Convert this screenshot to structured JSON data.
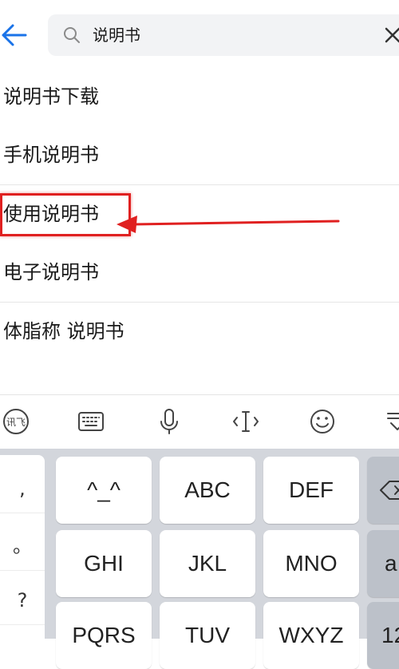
{
  "search": {
    "query": "说明书"
  },
  "suggestions": [
    {
      "label": "说明书下载"
    },
    {
      "label": "手机说明书"
    },
    {
      "label": "使用说明书"
    },
    {
      "label": "电子说明书"
    },
    {
      "label": "体脂称 说明书"
    }
  ],
  "keyboard": {
    "toolbar_icons": [
      "voice-input-logo-icon",
      "keyboard-icon",
      "microphone-icon",
      "cursor-icon",
      "emoji-icon",
      "collapse-icon"
    ],
    "punctuation": [
      ",",
      "。",
      "?"
    ],
    "keys": [
      "^_^",
      "ABC",
      "DEF",
      "GHI",
      "JKL",
      "MNO",
      "PQRS",
      "TUV",
      "WXYZ"
    ],
    "side_keys": [
      "a",
      "12"
    ]
  },
  "colors": {
    "accent": "#1a73e8",
    "annotation": "#e02020"
  }
}
